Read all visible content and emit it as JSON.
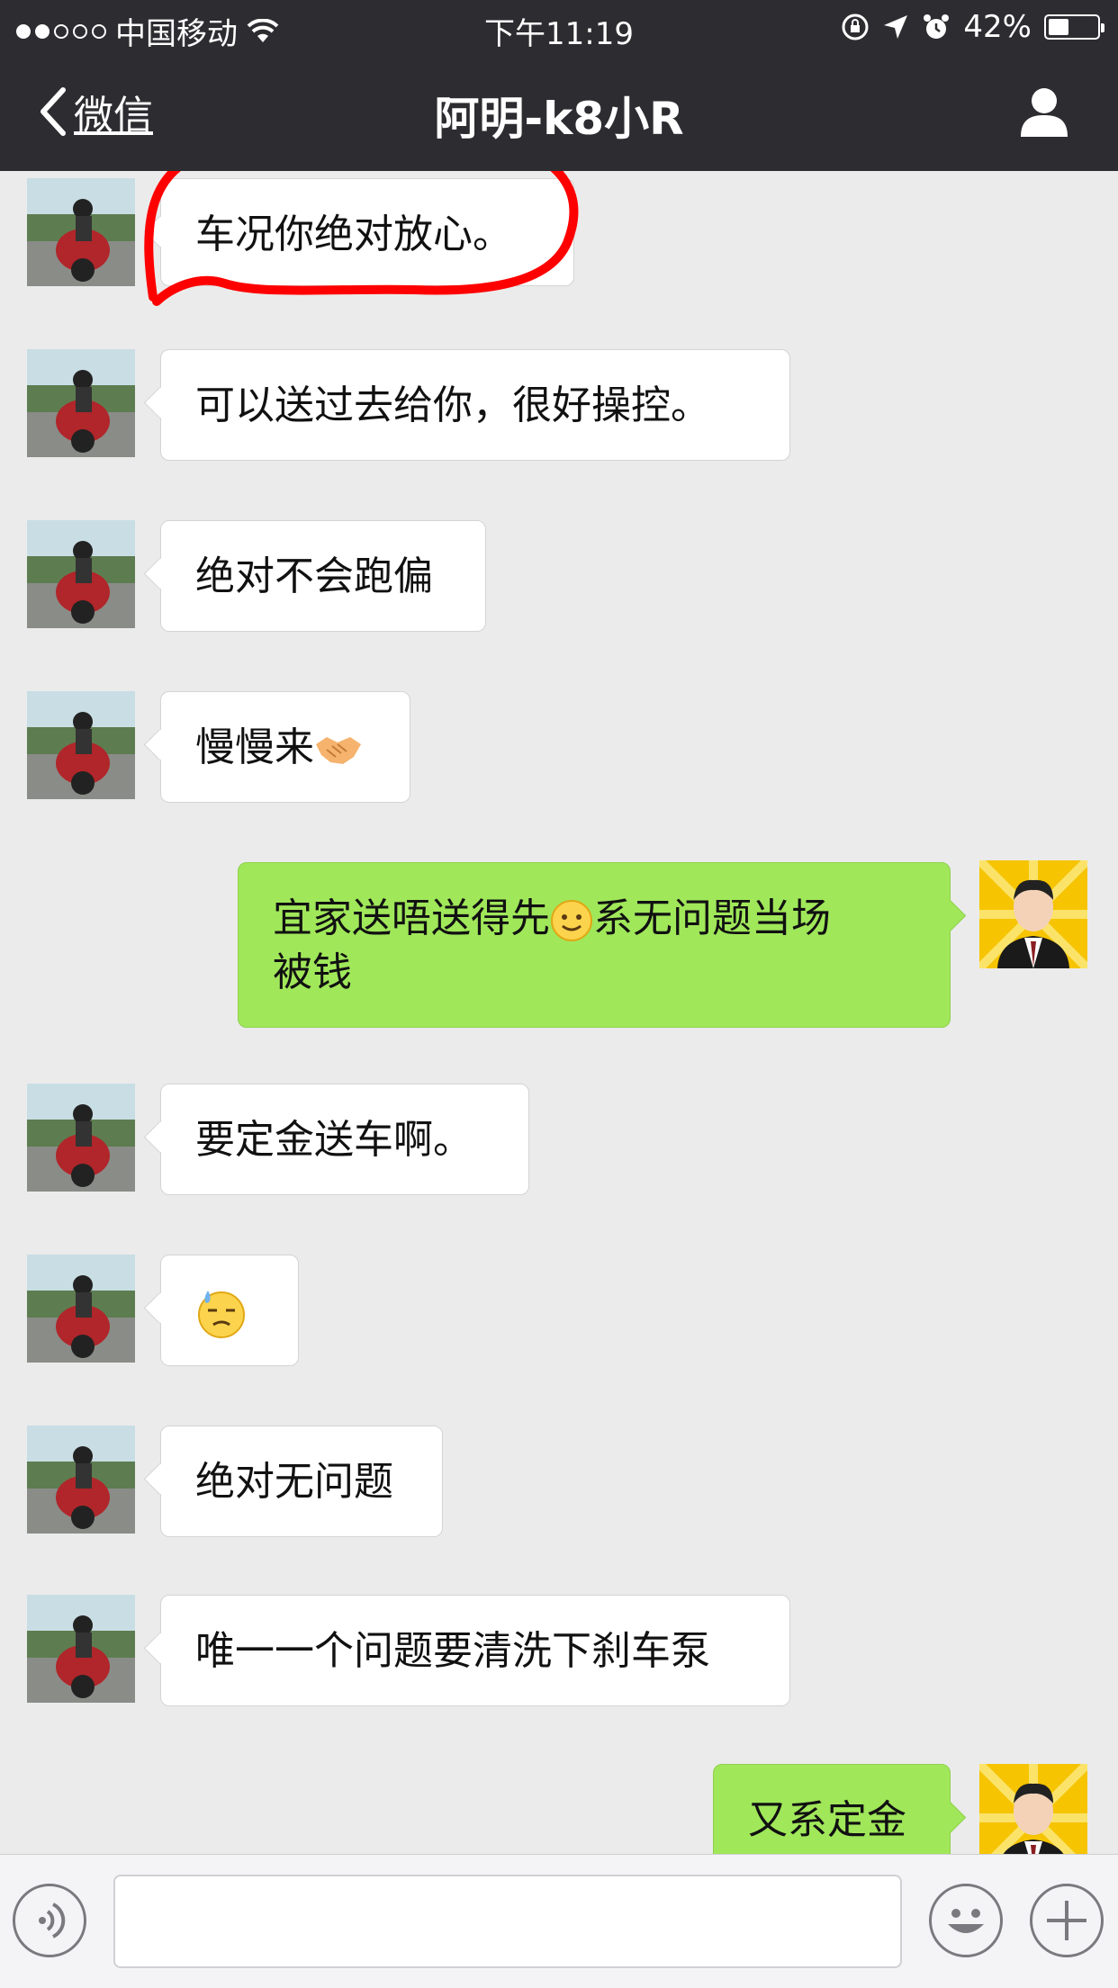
{
  "status_bar": {
    "carrier": "中国移动",
    "time": "下午11:19",
    "battery": "42%",
    "battery_level": 0.42,
    "signal_dots_filled": 2,
    "signal_dots_total": 5,
    "icons": [
      "wifi-icon",
      "orientation-lock-icon",
      "location-icon",
      "alarm-icon",
      "battery-icon"
    ]
  },
  "nav": {
    "back_label": "微信",
    "title": "阿明-k8小R",
    "icons": [
      "chevron-left-icon",
      "profile-icon"
    ]
  },
  "messages": [
    {
      "side": "in",
      "text": "车况你绝对放心。"
    },
    {
      "side": "in",
      "text": "可以送过去给你，很好操控。"
    },
    {
      "side": "in",
      "text": "绝对不会跑偏"
    },
    {
      "side": "in",
      "text": "慢慢来",
      "emoji": "handshake-emoji"
    },
    {
      "side": "out",
      "text_before": "宜家送唔送得先",
      "emoji": "smile-emoji",
      "text_after": "系无问题当场",
      "text_line2": "被钱"
    },
    {
      "side": "in",
      "text": "要定金送车啊。"
    },
    {
      "side": "in",
      "emoji": "sweat-emoji"
    },
    {
      "side": "in",
      "text": "绝对无问题"
    },
    {
      "side": "in",
      "text": "唯一一个问题要清洗下刹车泵"
    },
    {
      "side": "out",
      "text": "又系定金"
    }
  ],
  "avatars": {
    "contact": "motorcycle-rider-avatar",
    "self": "boy-portrait-avatar"
  },
  "input_bar": {
    "icons": [
      "voice-icon",
      "emoji-face-icon",
      "plus-icon"
    ],
    "placeholder": ""
  },
  "colors": {
    "nav_bg": "#2d2d31",
    "chat_bg": "#ebebeb",
    "out_bubble": "#a0e75a",
    "in_bubble": "#ffffff",
    "annotation_red": "#ff0000"
  }
}
